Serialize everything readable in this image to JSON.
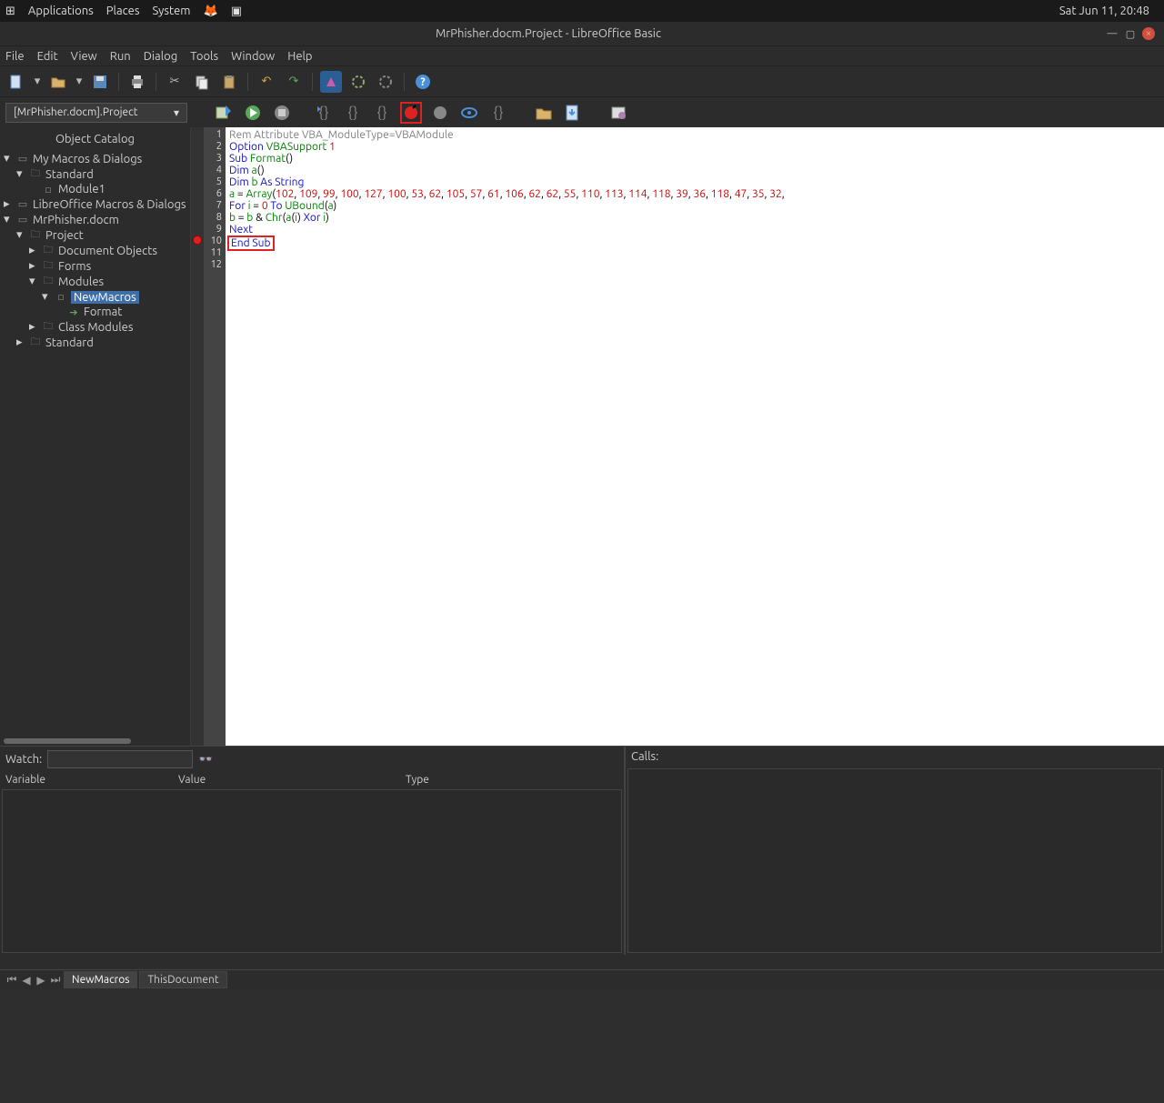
{
  "system": {
    "apps": "Applications",
    "places": "Places",
    "system": "System",
    "clock": "Sat Jun 11, 20:48"
  },
  "window": {
    "title": "MrPhisher.docm.Project - LibreOffice Basic"
  },
  "menu": {
    "file": "File",
    "edit": "Edit",
    "view": "View",
    "run": "Run",
    "dialog": "Dialog",
    "tools": "Tools",
    "window": "Window",
    "help": "Help"
  },
  "library_selector": "[MrPhisher.docm].Project",
  "catalog": {
    "title": "Object Catalog",
    "my_macros": "My Macros & Dialogs",
    "standard1": "Standard",
    "module1": "Module1",
    "lo_macros": "LibreOffice Macros & Dialogs",
    "mrphisher": "MrPhisher.docm",
    "project": "Project",
    "doc_objects": "Document Objects",
    "forms": "Forms",
    "modules": "Modules",
    "newmacros": "NewMacros",
    "format": "Format",
    "class_modules": "Class Modules",
    "standard2": "Standard"
  },
  "code": {
    "l1": "Rem Attribute VBA_ModuleType=VBAModule",
    "l2a": "Option",
    "l2b": "VBASupport",
    "l2c": "1",
    "l3a": "Sub",
    "l3b": "Format",
    "l3c": "()",
    "l4a": "Dim",
    "l4b": "a",
    "l4c": "()",
    "l5a": "Dim",
    "l5b": "b",
    "l5c": "As String",
    "l6a": "a",
    "l6b": " = ",
    "l6c": "Array",
    "l6d": "(",
    "arr": [
      "102",
      "109",
      "99",
      "100",
      "127",
      "100",
      "53",
      "62",
      "105",
      "57",
      "61",
      "106",
      "62",
      "62",
      "55",
      "110",
      "113",
      "114",
      "118",
      "39",
      "36",
      "118",
      "47",
      "35",
      "32"
    ],
    "l7a": "For",
    "l7b": "i",
    "l7c": " = ",
    "l7d": "0",
    "l7e": " To ",
    "l7f": "UBound",
    "l7g": "(",
    "l7h": "a",
    "l7i": ")",
    "l8a": "b",
    "l8b": " = ",
    "l8c": "b",
    "l8d": " & ",
    "l8e": "Chr",
    "l8f": "(",
    "l8g": "a",
    "l8h": "(",
    "l8i": "i",
    "l8j": ")",
    "l8k": " Xor ",
    "l8l": "i",
    "l8m": ")",
    "l9": "Next",
    "l10a": "End",
    "l10b": "Sub"
  },
  "watch": {
    "label": "Watch:",
    "col1": "Variable",
    "col2": "Value",
    "col3": "Type"
  },
  "calls": {
    "label": "Calls:"
  },
  "tabs": {
    "newmacros": "NewMacros",
    "thisdoc": "ThisDocument"
  }
}
